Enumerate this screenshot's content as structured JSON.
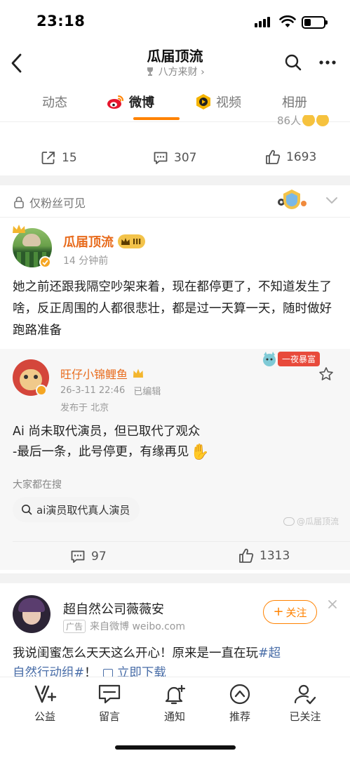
{
  "status_bar": {
    "time": "23:18"
  },
  "header": {
    "title": "瓜届顶流",
    "subtitle": "八方来财",
    "subtitle_icon": "trophy-icon"
  },
  "tabs": [
    {
      "label": "动态",
      "active": false
    },
    {
      "label": "微博",
      "active": true
    },
    {
      "label": "视频",
      "active": false
    },
    {
      "label": "相册",
      "active": false
    }
  ],
  "prev_post": {
    "partial_text": "86人",
    "reposts": "15",
    "comments": "307",
    "likes": "1693"
  },
  "post": {
    "visibility": "仅粉丝可见",
    "author": "瓜届顶流",
    "author_badge": "III",
    "time": "14 分钟前",
    "text": "她之前还跟我隔空吵架来着，现在都停更了，不知道发生了啥，反正周围的人都很悲壮，都是过一天算一天，随时做好跑路准备",
    "quoted": {
      "author": "旺仔小锦鲤鱼",
      "date": "26-3-11 22:46",
      "edited": "已编辑",
      "location": "发布于 北京",
      "badge_text": "一夜暴富",
      "line1": "Ai 尚未取代演员，但已取代了观众",
      "line2": "-最后一条，此号停更，有缘再见",
      "emoji": "👋"
    },
    "trending_label": "大家都在搜",
    "trending_chip": "ai演员取代真人演员",
    "watermark": "@瓜届顶流",
    "comments": "97",
    "likes": "1313"
  },
  "ad": {
    "author": "超自然公司薇薇安",
    "ad_tag": "广告",
    "source": "来自微博 weibo.com",
    "follow_label": "关注",
    "text_prefix": "我说闺蜜怎么天天这么开心！原来是一直在玩",
    "hashtag_part1": "#超",
    "hashtag_part2": "自然行动组#",
    "text_bang": "！",
    "download": "立即下载"
  },
  "bottom_nav": [
    {
      "label": "公益",
      "icon": "charity-v-icon"
    },
    {
      "label": "留言",
      "icon": "message-icon"
    },
    {
      "label": "通知",
      "icon": "bell-plus-icon"
    },
    {
      "label": "推荐",
      "icon": "recommend-up-icon"
    },
    {
      "label": "已关注",
      "icon": "user-check-icon"
    }
  ],
  "colors": {
    "accent": "#ff8200",
    "link": "#4a6ea8",
    "name": "#e86b1c"
  }
}
